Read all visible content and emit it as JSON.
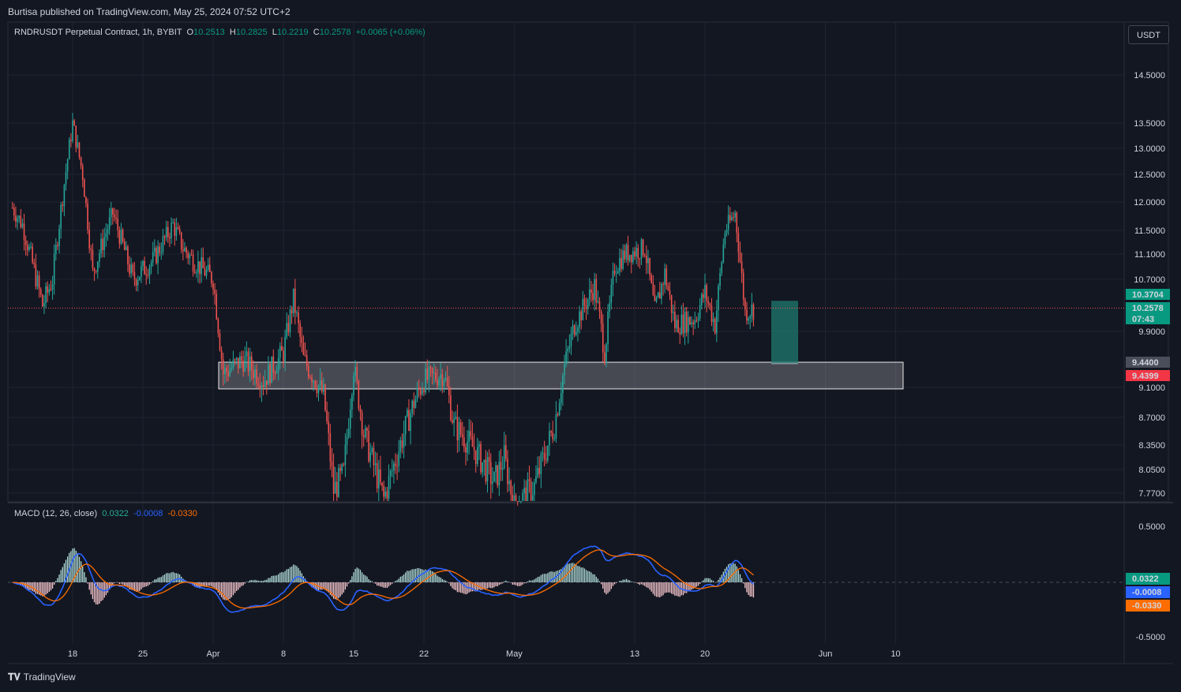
{
  "header": {
    "published_by": "Burtisa published on TradingView.com, May 25, 2024 07:52 UTC+2"
  },
  "legend": {
    "symbol": "RNDRUSDT Perpetual Contract, 1h, BYBIT",
    "open_label": "O",
    "open": "10.2513",
    "high_label": "H",
    "high": "10.2825",
    "low_label": "L",
    "low": "10.2219",
    "close_label": "C",
    "close": "10.2578",
    "change": "+0.0065 (+0.06%)"
  },
  "macd_legend": {
    "title": "MACD (12, 26, close)",
    "hist": "0.0322",
    "macd": "-0.0008",
    "signal": "-0.0330"
  },
  "currency": "USDT",
  "footer": {
    "brand": "TradingView"
  },
  "colors": {
    "background": "#131722",
    "grid": "#1f2330",
    "up": "#26a69a",
    "down": "#ef5350",
    "macd_line": "#2962ff",
    "signal_line": "#ff6d00",
    "zone_fill": "#ffffff",
    "target_box": "#1f7a6f"
  },
  "chart_data": [
    {
      "type": "candlestick",
      "title": "RNDRUSDT Perpetual Contract, 1h, BYBIT",
      "price_scale_labels": [
        "14.5000",
        "13.5000",
        "13.0000",
        "12.5000",
        "12.0000",
        "11.5000",
        "11.1000",
        "10.7000",
        "9.9000",
        "9.1000",
        "8.7000",
        "8.3500",
        "8.0500",
        "7.7700"
      ],
      "time_labels": [
        "18",
        "25",
        "Apr",
        "8",
        "15",
        "22",
        "May",
        "13",
        "20",
        "Jun",
        "10"
      ],
      "price_markers": [
        {
          "label": "10.3704",
          "role": "target-top",
          "color": "#089981"
        },
        {
          "label": "10.2578",
          "role": "last-price",
          "color": "#089981"
        },
        {
          "label": "07:43",
          "role": "countdown",
          "color": "#089981"
        },
        {
          "label": "9.4400",
          "role": "target-bottom",
          "color": "#4a4e5a"
        },
        {
          "label": "9.4399",
          "role": "stop",
          "color": "#f23645"
        }
      ],
      "last_price": 10.2578,
      "support_zone": {
        "from": 9.08,
        "to": 9.46
      },
      "target_box": {
        "from": 9.44,
        "to": 10.37
      },
      "path_keypoints": [
        [
          "Mar 12",
          11.9
        ],
        [
          "Mar 13",
          11.6
        ],
        [
          "Mar 15",
          10.3
        ],
        [
          "Mar 16",
          10.7
        ],
        [
          "Mar 18",
          13.5
        ],
        [
          "Mar 19",
          12.5
        ],
        [
          "Mar 20",
          10.8
        ],
        [
          "Mar 22",
          11.8
        ],
        [
          "Mar 24",
          10.7
        ],
        [
          "Mar 26",
          11.0
        ],
        [
          "Mar 28",
          11.6
        ],
        [
          "Mar 29",
          11.2
        ],
        [
          "Mar 30",
          11.0
        ],
        [
          "Apr 1",
          10.7
        ],
        [
          "Apr 2",
          9.3
        ],
        [
          "Apr 4",
          9.5
        ],
        [
          "Apr 6",
          9.2
        ],
        [
          "Apr 8",
          9.6
        ],
        [
          "Apr 9",
          10.4
        ],
        [
          "Apr 10",
          9.5
        ],
        [
          "Apr 12",
          9.0
        ],
        [
          "Apr 13",
          7.8
        ],
        [
          "Apr 14",
          8.0
        ],
        [
          "Apr 15",
          9.4
        ],
        [
          "Apr 16",
          8.5
        ],
        [
          "Apr 18",
          7.7
        ],
        [
          "Apr 19",
          8.1
        ],
        [
          "Apr 21",
          8.9
        ],
        [
          "Apr 22",
          9.2
        ],
        [
          "Apr 24",
          9.3
        ],
        [
          "Apr 25",
          8.6
        ],
        [
          "Apr 27",
          8.3
        ],
        [
          "Apr 29",
          7.9
        ],
        [
          "Apr 30",
          8.2
        ],
        [
          "May 1",
          7.6
        ],
        [
          "May 3",
          7.85
        ],
        [
          "May 5",
          8.6
        ],
        [
          "May 6",
          9.4
        ],
        [
          "May 7",
          10.0
        ],
        [
          "May 9",
          10.6
        ],
        [
          "May 10",
          9.6
        ],
        [
          "May 11",
          10.9
        ],
        [
          "May 12",
          11.1
        ],
        [
          "May 14",
          11.2
        ],
        [
          "May 15",
          10.2
        ],
        [
          "May 16",
          10.8
        ],
        [
          "May 17",
          10.0
        ],
        [
          "May 19",
          10.1
        ],
        [
          "May 20",
          10.5
        ],
        [
          "May 21",
          10.0
        ],
        [
          "May 22",
          11.5
        ],
        [
          "May 23",
          11.8
        ],
        [
          "May 24",
          10.2
        ],
        [
          "May 25",
          10.26
        ]
      ]
    },
    {
      "type": "macd",
      "title": "MACD (12, 26, close)",
      "price_scale_labels": [
        "0.5000",
        "-0.5000"
      ],
      "value_markers": [
        {
          "label": "0.0322",
          "series": "histogram",
          "color": "#089981"
        },
        {
          "label": "-0.0008",
          "series": "macd",
          "color": "#2962ff"
        },
        {
          "label": "-0.0330",
          "series": "signal",
          "color": "#ff6d00"
        }
      ],
      "ylim": [
        -0.5,
        0.5
      ]
    }
  ]
}
